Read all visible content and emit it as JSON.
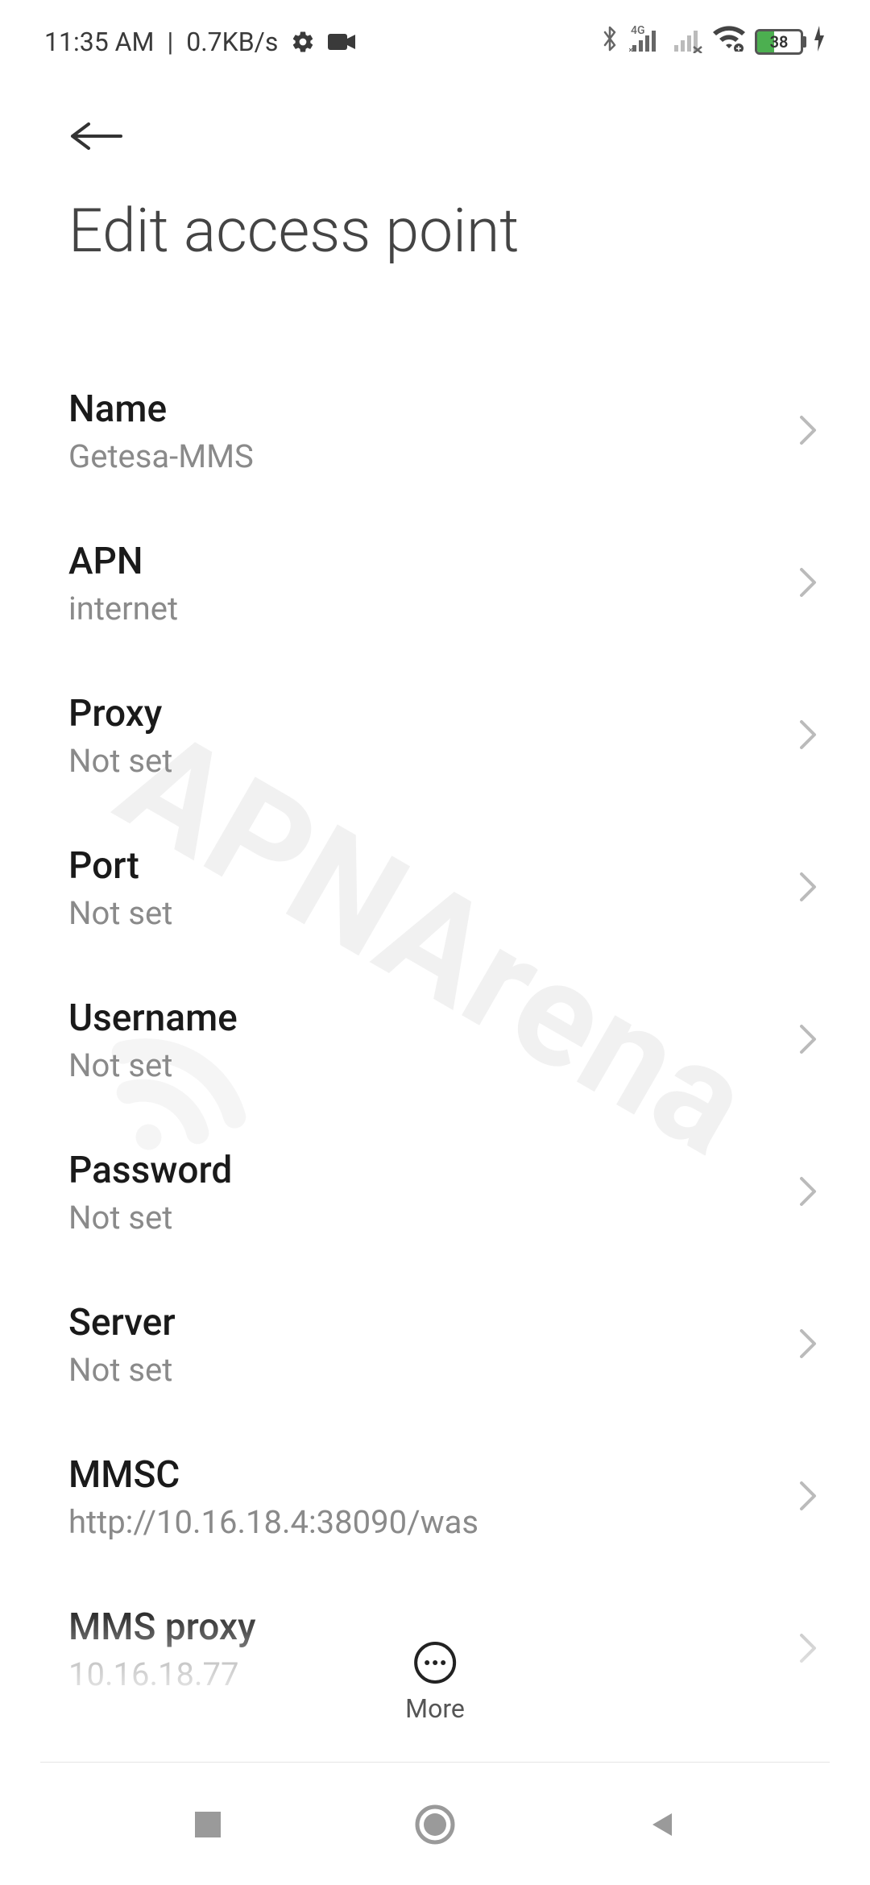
{
  "status": {
    "time": "11:35 AM",
    "speed": "0.7KB/s",
    "battery_percent": "38",
    "network_label": "4G"
  },
  "page_title": "Edit access point",
  "settings": [
    {
      "label": "Name",
      "value": "Getesa-MMS"
    },
    {
      "label": "APN",
      "value": "internet"
    },
    {
      "label": "Proxy",
      "value": "Not set"
    },
    {
      "label": "Port",
      "value": "Not set"
    },
    {
      "label": "Username",
      "value": "Not set"
    },
    {
      "label": "Password",
      "value": "Not set"
    },
    {
      "label": "Server",
      "value": "Not set"
    },
    {
      "label": "MMSC",
      "value": "http://10.16.18.4:38090/was"
    },
    {
      "label": "MMS proxy",
      "value": "10.16.18.77"
    }
  ],
  "more_label": "More",
  "watermark_text": "APNArena"
}
